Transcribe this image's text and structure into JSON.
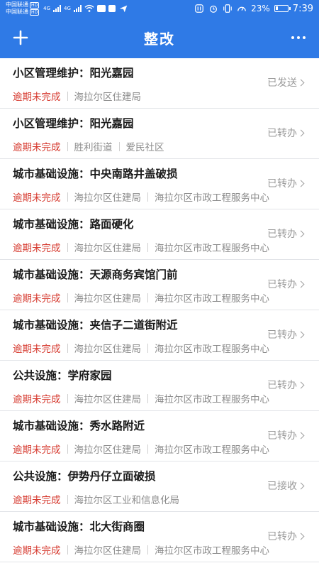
{
  "statusbar": {
    "carrier1": "中国联通",
    "carrier2": "中国联通",
    "hd": "HD",
    "net1": "4G",
    "net2": "4G",
    "battery_pct": "23%",
    "battery_level": 0.23,
    "time": "7:39"
  },
  "header": {
    "title": "整改",
    "add_icon": "plus-icon",
    "more_icon": "more-dots-icon"
  },
  "items": [
    {
      "title": "小区管理维护：阳光嘉园",
      "overdue": "逾期未完成",
      "dept1": "海拉尔区住建局",
      "dept2": "",
      "status": "已发送"
    },
    {
      "title": "小区管理维护：阳光嘉园",
      "overdue": "逾期未完成",
      "dept1": "胜利街道",
      "dept2": "爱民社区",
      "status": "已转办"
    },
    {
      "title": "城市基础设施：中央南路井盖破损",
      "overdue": "逾期未完成",
      "dept1": "海拉尔区住建局",
      "dept2": "海拉尔区市政工程服务中心",
      "status": "已转办"
    },
    {
      "title": "城市基础设施：路面硬化",
      "overdue": "逾期未完成",
      "dept1": "海拉尔区住建局",
      "dept2": "海拉尔区市政工程服务中心",
      "status": "已转办"
    },
    {
      "title": "城市基础设施：天源商务宾馆门前",
      "overdue": "逾期未完成",
      "dept1": "海拉尔区住建局",
      "dept2": "海拉尔区市政工程服务中心",
      "status": "已转办"
    },
    {
      "title": "城市基础设施：夹信子二道街附近",
      "overdue": "逾期未完成",
      "dept1": "海拉尔区住建局",
      "dept2": "海拉尔区市政工程服务中心",
      "status": "已转办"
    },
    {
      "title": "公共设施：学府家园",
      "overdue": "逾期未完成",
      "dept1": "海拉尔区住建局",
      "dept2": "海拉尔区市政工程服务中心",
      "status": "已转办"
    },
    {
      "title": "城市基础设施：秀水路附近",
      "overdue": "逾期未完成",
      "dept1": "海拉尔区住建局",
      "dept2": "海拉尔区市政工程服务中心",
      "status": "已转办"
    },
    {
      "title": "公共设施：伊势丹仔立面破损",
      "overdue": "逾期未完成",
      "dept1": "海拉尔区工业和信息化局",
      "dept2": "",
      "status": "已接收"
    },
    {
      "title": "城市基础设施：北大街商圈",
      "overdue": "逾期未完成",
      "dept1": "海拉尔区住建局",
      "dept2": "海拉尔区市政工程服务中心",
      "status": "已转办"
    }
  ]
}
